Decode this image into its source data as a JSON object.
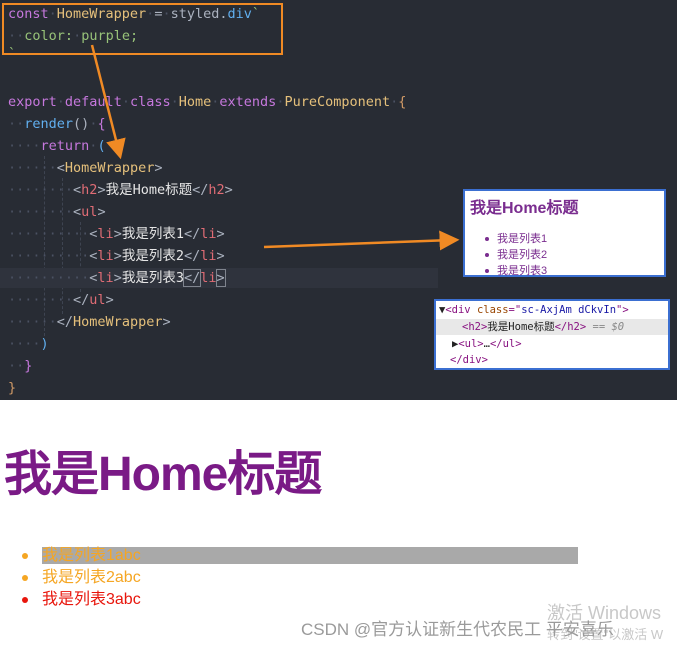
{
  "code": {
    "line1": {
      "kw": "const",
      "name": "HomeWrapper",
      "op": "=",
      "obj": "styled",
      "dot": ".",
      "tag": "div",
      "tick": "`"
    },
    "line2": {
      "prop": "color",
      "colon": ":",
      "val": "purple",
      "semi": ";"
    },
    "line3": {
      "tick": "`"
    },
    "line5": {
      "kw1": "export",
      "kw2": "default",
      "kw3": "class",
      "name": "Home",
      "kw4": "extends",
      "base": "PureComponent",
      "brace": "{"
    },
    "line6": {
      "fn": "render",
      "parens": "()",
      "brace": "{"
    },
    "line7": {
      "kw": "return",
      "paren": "("
    },
    "line8": {
      "open": "<",
      "tag": "HomeWrapper",
      "close": ">"
    },
    "line9": {
      "open": "<",
      "tag": "h2",
      "close": ">",
      "text": "我是Home标题",
      "endopen": "</",
      "endtag": "h2",
      "endclose": ">"
    },
    "line10": {
      "open": "<",
      "tag": "ul",
      "close": ">"
    },
    "line11": {
      "open": "<",
      "tag": "li",
      "close": ">",
      "text": "我是列表1",
      "endopen": "</",
      "endtag": "li",
      "endclose": ">"
    },
    "line12": {
      "open": "<",
      "tag": "li",
      "close": ">",
      "text": "我是列表2",
      "endopen": "</",
      "endtag": "li",
      "endclose": ">"
    },
    "line13": {
      "open": "<",
      "tag": "li",
      "close": ">",
      "text": "我是列表3",
      "endopen": "</",
      "endtag": "li",
      "endclose": ">"
    },
    "line14": {
      "open": "</",
      "tag": "ul",
      "close": ">"
    },
    "line15": {
      "open": "</",
      "tag": "HomeWrapper",
      "close": ">"
    },
    "line16": {
      "paren": ")"
    },
    "line17": {
      "brace": "}"
    },
    "line18": {
      "brace": "}"
    }
  },
  "preview": {
    "title": "我是Home标题",
    "items": [
      "我是列表1",
      "我是列表2",
      "我是列表3"
    ]
  },
  "devtools": {
    "row1": {
      "arrow": "▼",
      "open": "<div ",
      "attr": "class",
      "eq": "=\"",
      "val": "sc-AxjAm dCkvIn",
      "close": "\">"
    },
    "row2": {
      "open": "<h2>",
      "text": "我是Home标题",
      "close": "</h2>",
      "ref": " == $0"
    },
    "row3": {
      "arrow": "▶",
      "open": "<ul>",
      "text": "…",
      "close": "</ul>"
    },
    "row4": {
      "close": "</div>"
    }
  },
  "page": {
    "title": "我是Home标题",
    "items": [
      {
        "text": "我是列表1abc",
        "color": "#f5a623"
      },
      {
        "text": "我是列表2abc",
        "color": "#f5a623"
      },
      {
        "text": "我是列表3abc",
        "color": "#e8160c"
      }
    ]
  },
  "watermarks": {
    "windows_line1": "激活 Windows",
    "windows_line2": "转到\"设置\"以激活 W",
    "csdn": "CSDN @官方认证新生代农民工 平安喜乐"
  },
  "colors": {
    "editor_bg": "#282c34",
    "annotation": "#f08a24",
    "title_purple": "#7a1a86"
  }
}
